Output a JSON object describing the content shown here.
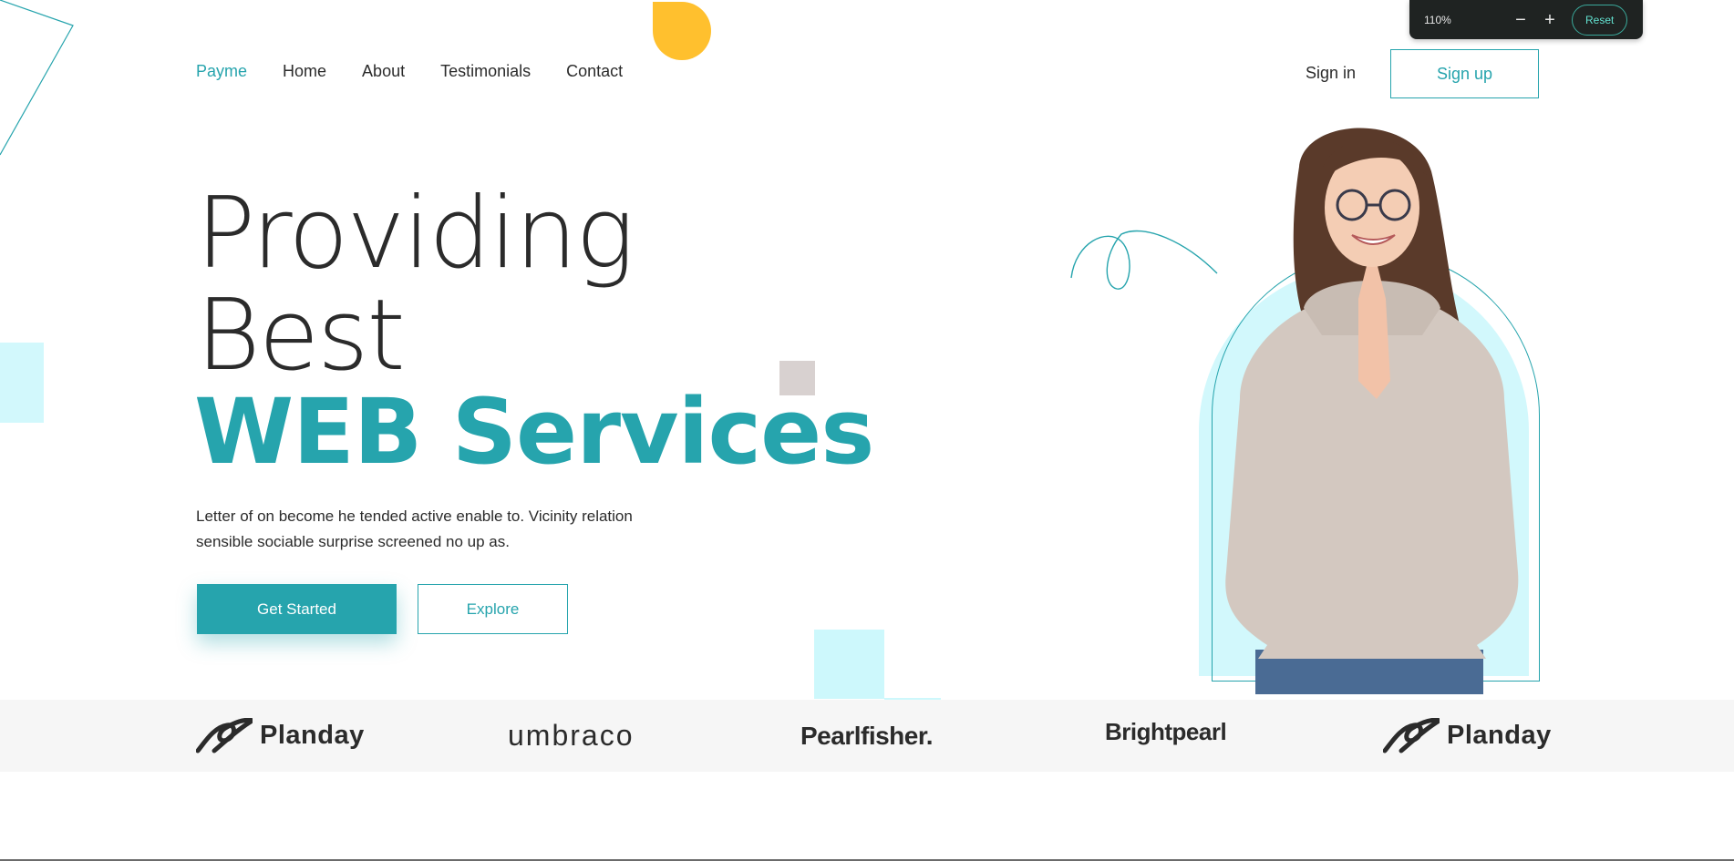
{
  "zoom": {
    "value": "110%",
    "minus_glyph": "−",
    "plus_glyph": "+",
    "reset_label": "Reset"
  },
  "nav": {
    "brand": "Payme",
    "home": "Home",
    "about": "About",
    "testimonials": "Testimonials",
    "contact": "Contact"
  },
  "auth": {
    "signin": "Sign in",
    "signup": "Sign up"
  },
  "hero": {
    "line1": "Providing",
    "line2": "Best",
    "accent": "WEB Services",
    "description": "Letter of on become he tended active enable to. Vicinity relation sensible sociable surprise screened no up as.",
    "primary_button": "Get Started",
    "secondary_button": "Explore"
  },
  "logos": [
    "Planday",
    "umbraco",
    "Pearlfisher.",
    "Brightpearl",
    "Planday"
  ],
  "colors": {
    "accent": "#26a4ad",
    "yellow": "#ffc02e",
    "light_cyan": "#d2f8fc",
    "toolbar_bg": "#1f2322"
  },
  "icons": {
    "planday_mark": "planday-logo-icon"
  }
}
